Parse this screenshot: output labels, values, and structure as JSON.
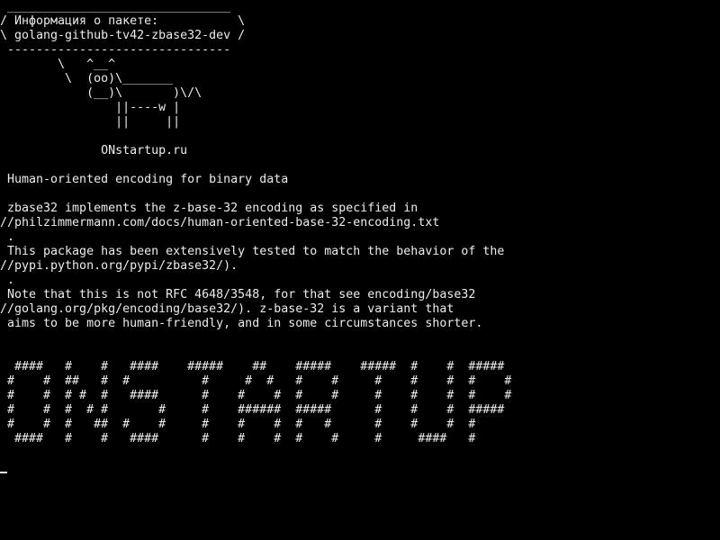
{
  "terminal": {
    "colors": {
      "background": "#000000",
      "foreground": "#ececec"
    },
    "lines": [
      " _______________________________",
      "/ Информация о пакете:           \\",
      "\\ golang-github-tv42-zbase32-dev /",
      " -------------------------------",
      "        \\   ^__^",
      "         \\  (oo)\\_______",
      "            (__)\\       )\\/\\",
      "                ||----w |",
      "                ||     ||",
      "",
      "              ONstartup.ru",
      "",
      " Human-oriented encoding for binary data",
      "",
      " zbase32 implements the z-base-32 encoding as specified in",
      "//philzimmermann.com/docs/human-oriented-base-32-encoding.txt",
      " .",
      " This package has been extensively tested to match the behavior of the",
      "//pypi.python.org/pypi/zbase32/).",
      " .",
      " Note that this is not RFC 4648/3548, for that see encoding/base32",
      "//golang.org/pkg/encoding/base32/). z-base-32 is a variant that",
      " aims to be more human-friendly, and in some circumstances shorter.",
      "",
      "",
      "  ####   #    #   ####    #####    ##    #####    #####  #    #  #####",
      " #    #  ##   #  #          #     #  #   #    #     #    #    #  #    #",
      " #    #  # #  #   ####      #    #    #  #    #     #    #    #  #    #",
      " #    #  #  # #       #     #    ######  #####      #    #    #  #####",
      " #    #  #   ##  #    #     #    #    #  #   #      #    #    #  #",
      "  ####   #    #   ####      #    #    #  #    #     #     ####   #"
    ]
  }
}
